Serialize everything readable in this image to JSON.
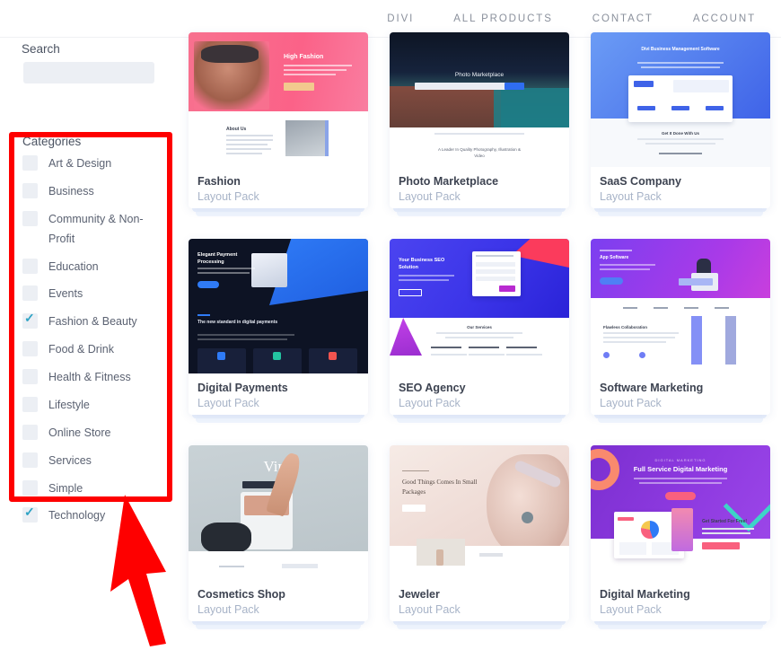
{
  "nav": {
    "items": [
      {
        "label": "DIVI",
        "name": "nav-divi"
      },
      {
        "label": "ALL PRODUCTS",
        "name": "nav-all-products"
      },
      {
        "label": "CONTACT",
        "name": "nav-contact"
      },
      {
        "label": "ACCOUNT",
        "name": "nav-account"
      }
    ]
  },
  "sidebar": {
    "search_label": "Search",
    "search_value": "",
    "search_placeholder": "",
    "categories_title": "Categories",
    "categories": [
      {
        "label": "Art & Design",
        "checked": false
      },
      {
        "label": "Business",
        "checked": false
      },
      {
        "label": "Community & Non-Profit",
        "checked": false
      },
      {
        "label": "Education",
        "checked": false
      },
      {
        "label": "Events",
        "checked": false
      },
      {
        "label": "Fashion & Beauty",
        "checked": true
      },
      {
        "label": "Food & Drink",
        "checked": false
      },
      {
        "label": "Health & Fitness",
        "checked": false
      },
      {
        "label": "Lifestyle",
        "checked": false
      },
      {
        "label": "Online Store",
        "checked": false
      },
      {
        "label": "Services",
        "checked": false
      },
      {
        "label": "Simple",
        "checked": false
      },
      {
        "label": "Technology",
        "checked": true
      }
    ]
  },
  "annotation": {
    "color": "#fe0000",
    "highlight_target": "categories-filter-panel",
    "arrow_direction": "up-left"
  },
  "cards": [
    {
      "title": "Fashion",
      "subtitle": "Layout Pack",
      "hero_text": "High Fashion",
      "body_text": "About Us",
      "theme": "fashion"
    },
    {
      "title": "Photo Marketplace",
      "subtitle": "Layout Pack",
      "hero_text": "Photo Marketplace",
      "body_text": "A Leader In Quality Photography, Illustration & Video",
      "theme": "photo"
    },
    {
      "title": "SaaS Company",
      "subtitle": "Layout Pack",
      "hero_text": "Divi Business Management Software",
      "body_text": "Get It Done With Us",
      "theme": "saas"
    },
    {
      "title": "Digital Payments",
      "subtitle": "Layout Pack",
      "hero_text": "Elegant Payment Processing",
      "body_text": "The new standard in digital payments",
      "theme": "payments"
    },
    {
      "title": "SEO Agency",
      "subtitle": "Layout Pack",
      "hero_text": "Your Business SEO Solution",
      "body_text": "Our Services",
      "theme": "seo"
    },
    {
      "title": "Software Marketing",
      "subtitle": "Layout Pack",
      "hero_text": "App Software",
      "body_text": "Flawless Collaboration",
      "theme": "software"
    },
    {
      "title": "Cosmetics Shop",
      "subtitle": "Layout Pack",
      "hero_text": "Vino",
      "body_text": "",
      "theme": "cosmetics"
    },
    {
      "title": "Jeweler",
      "subtitle": "Layout Pack",
      "hero_text": "Good Things Comes In Small Packages",
      "body_text": "",
      "theme": "jeweler"
    },
    {
      "title": "Digital Marketing",
      "subtitle": "Layout Pack",
      "hero_text": "Full Service Digital Marketing",
      "body_text": "Get Started For Free!",
      "theme": "marketing"
    }
  ]
}
